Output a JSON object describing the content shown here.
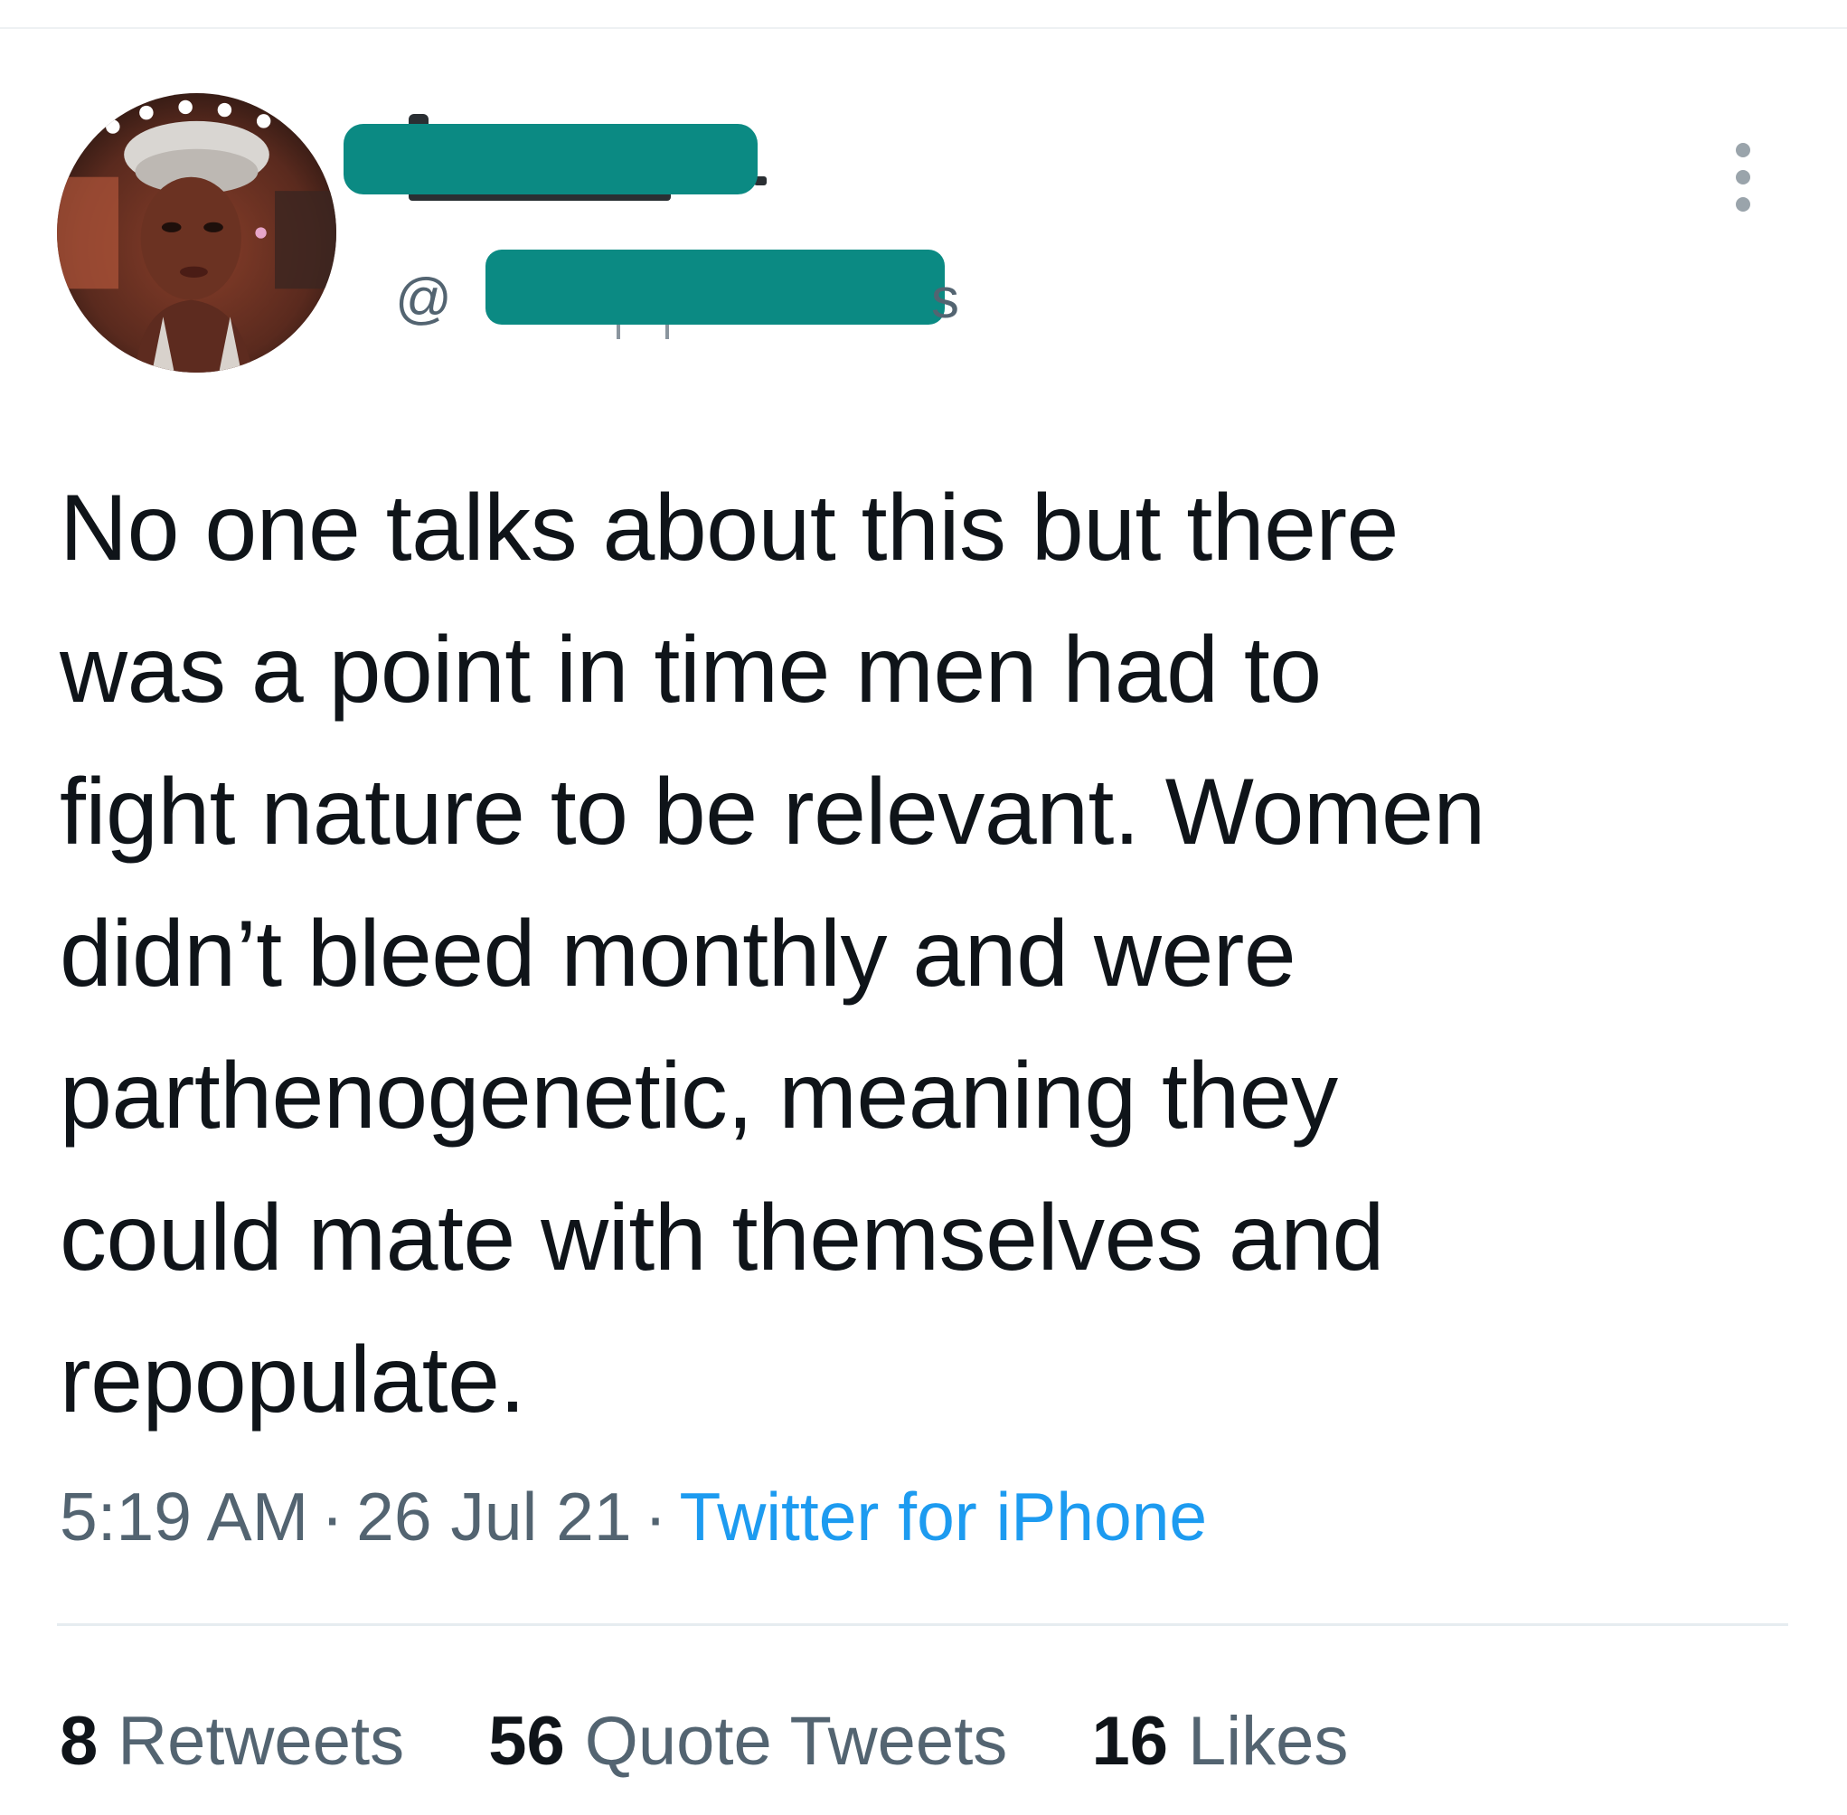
{
  "tweet": {
    "handle_prefix": "@",
    "handle_suffix": "s",
    "text_lines": [
      "No one talks about this but there",
      "was a point in time men had to",
      "fight nature to be relevant. Women",
      "didn’t bleed monthly and were",
      "parthenogenetic, meaning they",
      "could mate with themselves and",
      "repopulate."
    ],
    "time": "5:19 AM",
    "date": "26 Jul 21",
    "separator": "·",
    "source": "Twitter for iPhone"
  },
  "stats": {
    "retweets_count": "8",
    "retweets_label": "Retweets",
    "quotes_count": "56",
    "quotes_label": "Quote Tweets",
    "likes_count": "16",
    "likes_label": "Likes"
  },
  "colors": {
    "redaction": "#0b8a83",
    "secondary_text": "#536471",
    "link": "#1d9bf0",
    "primary_text": "#0f1419"
  },
  "icons": {
    "more": "more-vertical-icon"
  }
}
